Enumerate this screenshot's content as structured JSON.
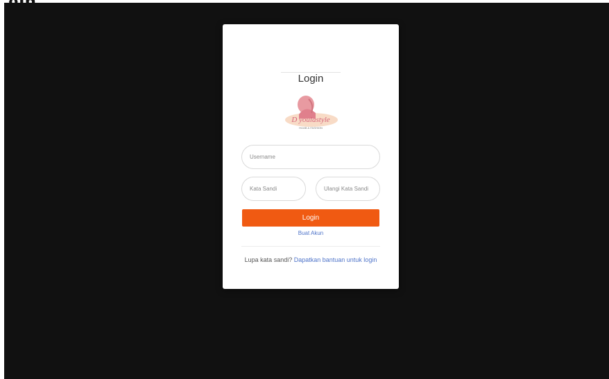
{
  "page": {
    "heading": "gin"
  },
  "card": {
    "title": "Login",
    "logo": {
      "brand": "D youlastyle",
      "tagline": "HIJAB & FASHION"
    },
    "fields": {
      "username_placeholder": "Username",
      "password_placeholder": "Kata Sandi",
      "repeat_password_placeholder": "Ulangi Kata Sandi"
    },
    "login_button": "Login",
    "create_account_link": "Buat Akun",
    "forgot_text": "Lupa kata sandi?",
    "help_link": "Dapatkan bantuan untuk login"
  },
  "colors": {
    "background": "#111111",
    "accent": "#f05a12",
    "link": "#4f74c9"
  }
}
